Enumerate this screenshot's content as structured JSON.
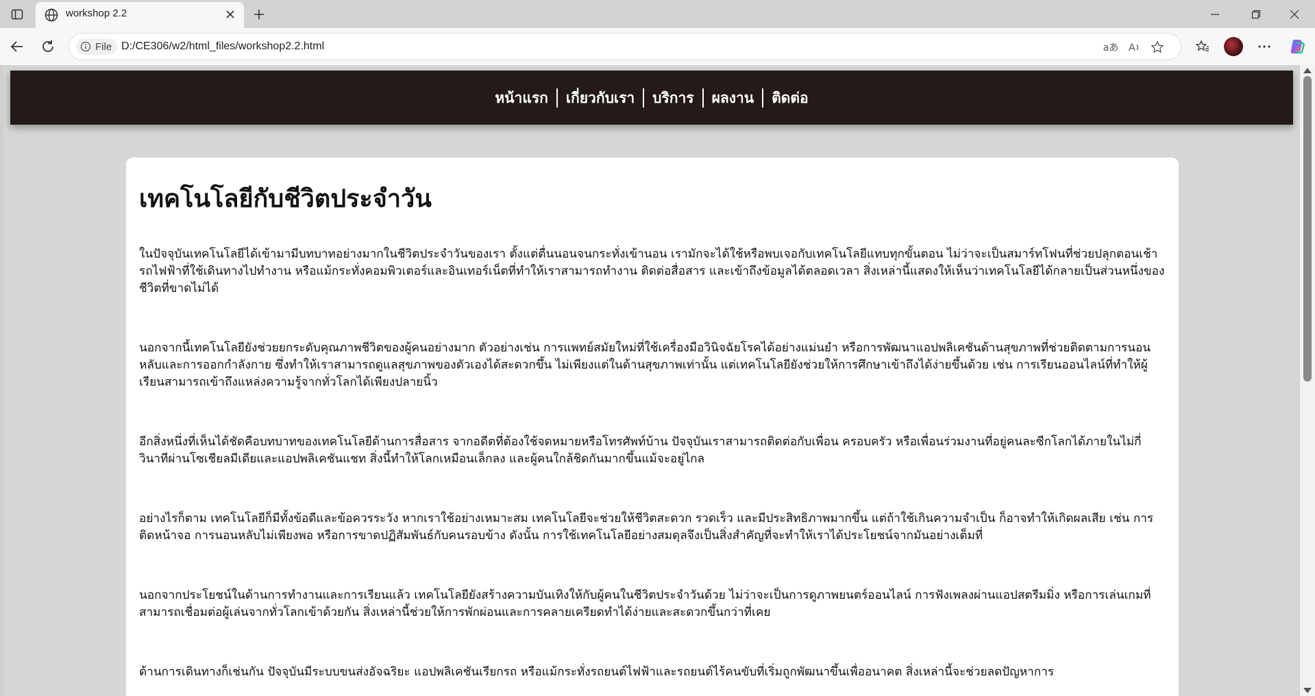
{
  "browser": {
    "tab_title": "workshop 2.2",
    "omnibox_badge": "File",
    "url": "D:/CE306/w2/html_files/workshop2.2.html",
    "read_aloud_glyph": "A",
    "translate_glyph": "aあ"
  },
  "nav": {
    "items": [
      "หน้าแรก",
      "เกี่ยวกับเรา",
      "บริการ",
      "ผลงาน",
      "ติดต่อ"
    ]
  },
  "article": {
    "title": "เทคโนโลยีกับชีวิตประจำวัน",
    "paragraphs": [
      "ในปัจจุบันเทคโนโลยีได้เข้ามามีบทบาทอย่างมากในชีวิตประจำวันของเรา ตั้งแต่ตื่นนอนจนกระทั่งเข้านอน เรามักจะได้ใช้หรือพบเจอกับเทคโนโลยีแทบทุกขั้นตอน ไม่ว่าจะเป็นสมาร์ทโฟนที่ช่วยปลุกตอนเช้า รถไฟฟ้าที่ใช้เดินทางไปทำงาน หรือแม้กระทั่งคอมพิวเตอร์และอินเทอร์เน็ตที่ทำให้เราสามารถทำงาน ติดต่อสื่อสาร และเข้าถึงข้อมูลได้ตลอดเวลา สิ่งเหล่านี้แสดงให้เห็นว่าเทคโนโลยีได้กลายเป็นส่วนหนึ่งของชีวิตที่ขาดไม่ได้",
      "นอกจากนี้เทคโนโลยียังช่วยยกระดับคุณภาพชีวิตของผู้คนอย่างมาก ตัวอย่างเช่น การแพทย์สมัยใหม่ที่ใช้เครื่องมือวินิจฉัยโรคได้อย่างแม่นยำ หรือการพัฒนาแอปพลิเคชันด้านสุขภาพที่ช่วยติดตามการนอนหลับและการออกกำลังกาย ซึ่งทำให้เราสามารถดูแลสุขภาพของตัวเองได้สะดวกขึ้น ไม่เพียงแต่ในด้านสุขภาพเท่านั้น แต่เทคโนโลยียังช่วยให้การศึกษาเข้าถึงได้ง่ายขึ้นด้วย เช่น การเรียนออนไลน์ที่ทำให้ผู้เรียนสามารถเข้าถึงแหล่งความรู้จากทั่วโลกได้เพียงปลายนิ้ว",
      "อีกสิ่งหนึ่งที่เห็นได้ชัดคือบทบาทของเทคโนโลยีด้านการสื่อสาร จากอดีตที่ต้องใช้จดหมายหรือโทรศัพท์บ้าน ปัจจุบันเราสามารถติดต่อกับเพื่อน ครอบครัว หรือเพื่อนร่วมงานที่อยู่คนละซีกโลกได้ภายในไม่กี่วินาทีผ่านโซเชียลมีเดียและแอปพลิเคชันแชท สิ่งนี้ทำให้โลกเหมือนเล็กลง และผู้คนใกล้ชิดกันมากขึ้นแม้จะอยู่ไกล",
      "อย่างไรก็ตาม เทคโนโลยีก็มีทั้งข้อดีและข้อควรระวัง หากเราใช้อย่างเหมาะสม เทคโนโลยีจะช่วยให้ชีวิตสะดวก รวดเร็ว และมีประสิทธิภาพมากขึ้น แต่ถ้าใช้เกินความจำเป็น ก็อาจทำให้เกิดผลเสีย เช่น การติดหน้าจอ การนอนหลับไม่เพียงพอ หรือการขาดปฏิสัมพันธ์กับคนรอบข้าง ดังนั้น การใช้เทคโนโลยีอย่างสมดุลจึงเป็นสิ่งสำคัญที่จะทำให้เราได้ประโยชน์จากมันอย่างเต็มที่",
      "นอกจากประโยชน์ในด้านการทำงานและการเรียนแล้ว เทคโนโลยียังสร้างความบันเทิงให้กับผู้คนในชีวิตประจำวันด้วย ไม่ว่าจะเป็นการดูภาพยนตร์ออนไลน์ การฟังเพลงผ่านแอปสตรีมมิ่ง หรือการเล่นเกมที่สามารถเชื่อมต่อผู้เล่นจากทั่วโลกเข้าด้วยกัน สิ่งเหล่านี้ช่วยให้การพักผ่อนและการคลายเครียดทำได้ง่ายและสะดวกขึ้นกว่าที่เคย",
      "ด้านการเดินทางก็เช่นกัน ปัจจุบันมีระบบขนส่งอัจฉริยะ แอปพลิเคชันเรียกรถ หรือแม้กระทั่งรถยนต์ไฟฟ้าและรถยนต์ไร้คนขับที่เริ่มถูกพัฒนาขึ้นเพื่ออนาคต สิ่งเหล่านี้จะช่วยลดปัญหาการ"
    ]
  }
}
